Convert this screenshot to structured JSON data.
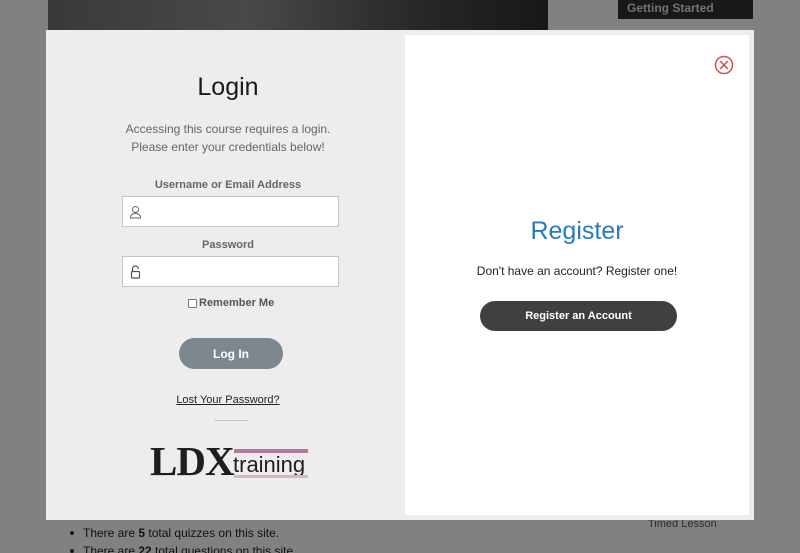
{
  "background": {
    "sidebar_title": "Getting Started",
    "stats": [
      {
        "prefix": "There are ",
        "count": "5",
        "suffix": " total quizzes on this site."
      },
      {
        "prefix": "There are ",
        "count": "22",
        "suffix": " total questions on this site."
      }
    ],
    "sidebar_item": "Timed Lesson"
  },
  "login": {
    "title": "Login",
    "description_line1": "Accessing this course requires a login.",
    "description_line2": "Please enter your credentials below!",
    "username_label": "Username or Email Address",
    "username_value": "",
    "password_label": "Password",
    "password_value": "",
    "remember_label": "Remember Me",
    "login_button": "Log In",
    "lost_password": "Lost Your Password?"
  },
  "logo": {
    "brand": "LDX",
    "product": "training"
  },
  "register": {
    "title": "Register",
    "description": "Don't have an account? Register one!",
    "button": "Register an Account"
  },
  "colors": {
    "register_title": "#2b79be",
    "login_button": "#7d878e",
    "register_button": "#404040",
    "close_icon": "#d9534f"
  },
  "icons": {
    "username": "user-icon",
    "password": "lock-icon",
    "close": "close-circle-icon"
  }
}
